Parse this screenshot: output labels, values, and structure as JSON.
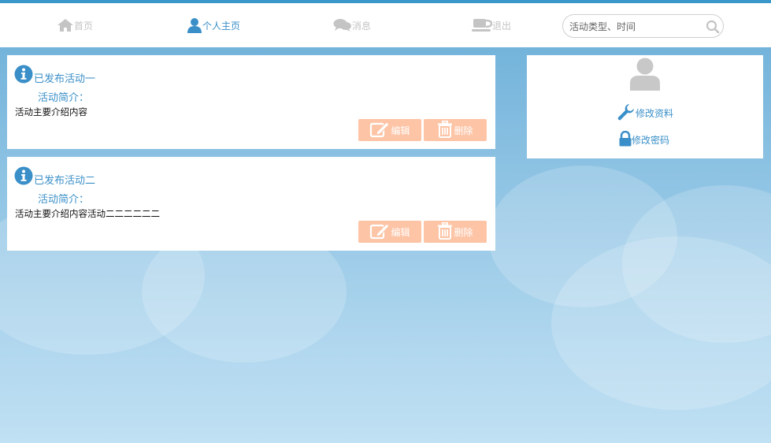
{
  "nav": {
    "items": [
      {
        "label": "首页",
        "icon": "home-icon"
      },
      {
        "label": "个人主页",
        "icon": "user-icon",
        "active": true
      },
      {
        "label": "消息",
        "icon": "chat-icon"
      },
      {
        "label": "退出",
        "icon": "cup-icon"
      }
    ],
    "search_placeholder": "活动类型、时间"
  },
  "activities": [
    {
      "title": "已发布活动一",
      "intro_label": "活动简介：",
      "intro_text": "活动主要介绍内容",
      "edit_label": "编辑",
      "delete_label": "删除"
    },
    {
      "title": "已发布活动二",
      "intro_label": "活动简介：",
      "intro_text": "活动主要介绍内容活动二二二二二二",
      "edit_label": "编辑",
      "delete_label": "删除"
    }
  ],
  "profile": {
    "edit_profile_label": "修改资料",
    "change_password_label": "修改密码"
  },
  "colors": {
    "accent": "#3a8fc8",
    "nav_inactive": "#c4c4c4",
    "button": "#fdc4a6",
    "top_line": "#3a97c9"
  }
}
